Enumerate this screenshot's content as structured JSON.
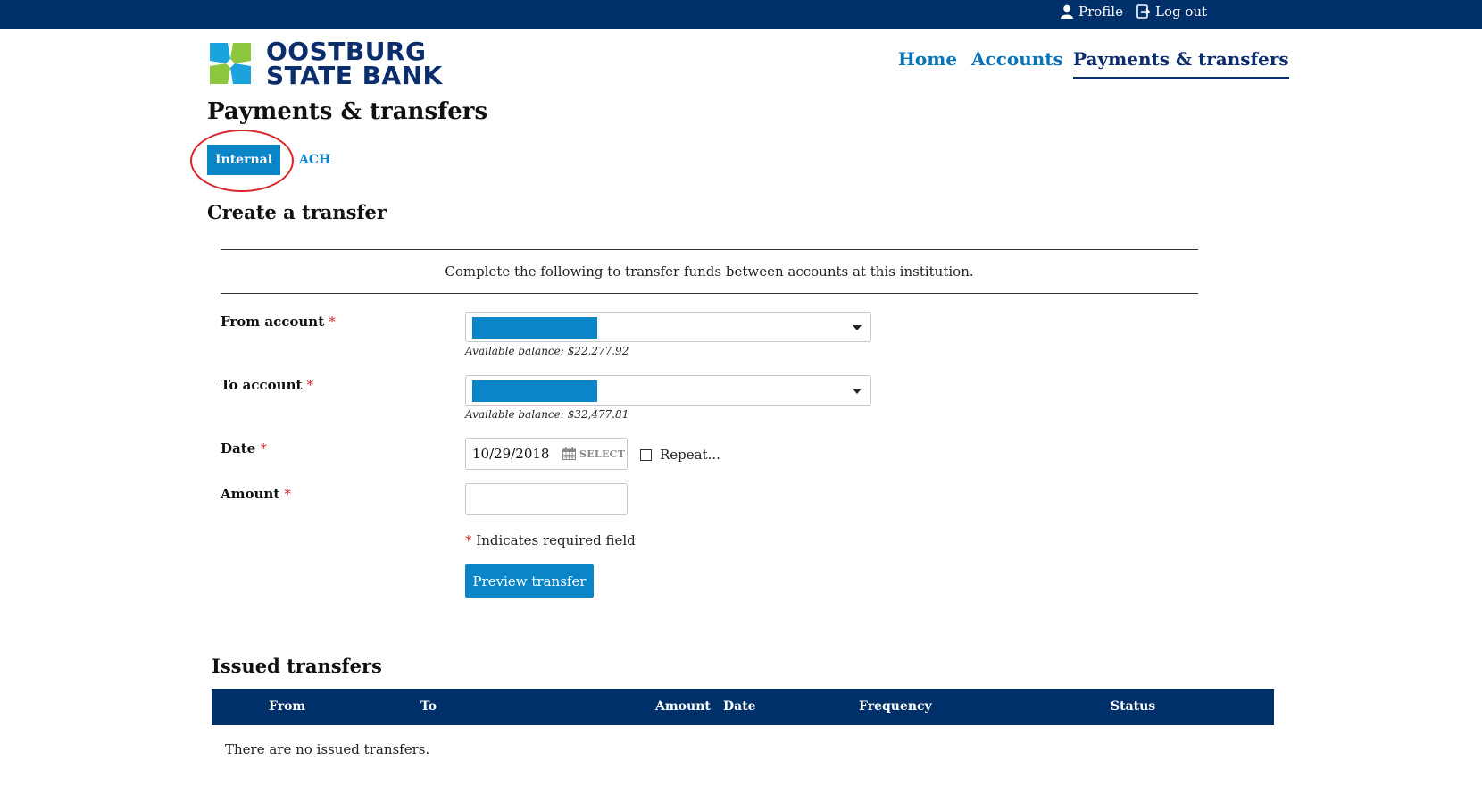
{
  "topbar": {
    "profile_label": "Profile",
    "logout_label": "Log out"
  },
  "brand": {
    "line1": "OOSTBURG",
    "line2": "STATE BANK"
  },
  "nav": {
    "home": "Home",
    "accounts": "Accounts",
    "payments": "Payments & transfers"
  },
  "page": {
    "title": "Payments & transfers"
  },
  "tabs": {
    "internal": "Internal",
    "ach": "ACH"
  },
  "form": {
    "title": "Create a transfer",
    "intro": "Complete the following to transfer funds between accounts at this institution.",
    "from_label": "From account",
    "from_balance": "Available balance: $22,277.92",
    "to_label": "To account",
    "to_balance": "Available balance: $32,477.81",
    "date_label": "Date",
    "date_value": "10/29/2018",
    "date_select": "SELECT",
    "repeat_label": "Repeat...",
    "amount_label": "Amount",
    "amount_value": "",
    "required_marker": "*",
    "required_note": "Indicates required field",
    "preview_button": "Preview transfer"
  },
  "issued": {
    "title": "Issued transfers",
    "columns": {
      "from": "From",
      "to": "To",
      "amount": "Amount",
      "date": "Date",
      "frequency": "Frequency",
      "status": "Status"
    },
    "empty": "There are no issued transfers."
  },
  "colors": {
    "topbar": "#00306a",
    "accent": "#0a85c7",
    "brand_navy": "#0b2d6b",
    "logo_green": "#8dc63f",
    "logo_blue": "#1aa3dc",
    "annotation_red": "#d9262c"
  }
}
